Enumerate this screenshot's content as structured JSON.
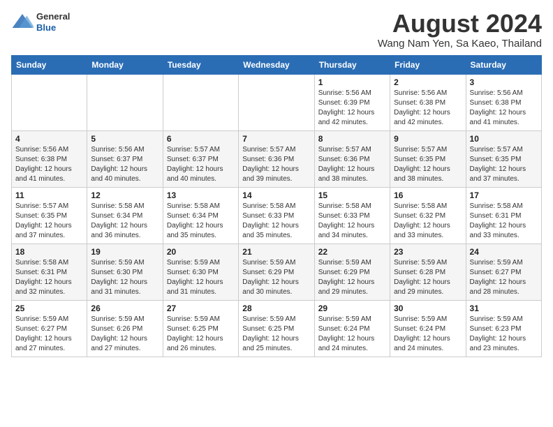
{
  "header": {
    "logo": {
      "general": "General",
      "blue": "Blue"
    },
    "title": "August 2024",
    "subtitle": "Wang Nam Yen, Sa Kaeo, Thailand"
  },
  "weekdays": [
    "Sunday",
    "Monday",
    "Tuesday",
    "Wednesday",
    "Thursday",
    "Friday",
    "Saturday"
  ],
  "weeks": [
    [
      {
        "day": "",
        "info": ""
      },
      {
        "day": "",
        "info": ""
      },
      {
        "day": "",
        "info": ""
      },
      {
        "day": "",
        "info": ""
      },
      {
        "day": "1",
        "info": "Sunrise: 5:56 AM\nSunset: 6:39 PM\nDaylight: 12 hours\nand 42 minutes."
      },
      {
        "day": "2",
        "info": "Sunrise: 5:56 AM\nSunset: 6:38 PM\nDaylight: 12 hours\nand 42 minutes."
      },
      {
        "day": "3",
        "info": "Sunrise: 5:56 AM\nSunset: 6:38 PM\nDaylight: 12 hours\nand 41 minutes."
      }
    ],
    [
      {
        "day": "4",
        "info": "Sunrise: 5:56 AM\nSunset: 6:38 PM\nDaylight: 12 hours\nand 41 minutes."
      },
      {
        "day": "5",
        "info": "Sunrise: 5:56 AM\nSunset: 6:37 PM\nDaylight: 12 hours\nand 40 minutes."
      },
      {
        "day": "6",
        "info": "Sunrise: 5:57 AM\nSunset: 6:37 PM\nDaylight: 12 hours\nand 40 minutes."
      },
      {
        "day": "7",
        "info": "Sunrise: 5:57 AM\nSunset: 6:36 PM\nDaylight: 12 hours\nand 39 minutes."
      },
      {
        "day": "8",
        "info": "Sunrise: 5:57 AM\nSunset: 6:36 PM\nDaylight: 12 hours\nand 38 minutes."
      },
      {
        "day": "9",
        "info": "Sunrise: 5:57 AM\nSunset: 6:35 PM\nDaylight: 12 hours\nand 38 minutes."
      },
      {
        "day": "10",
        "info": "Sunrise: 5:57 AM\nSunset: 6:35 PM\nDaylight: 12 hours\nand 37 minutes."
      }
    ],
    [
      {
        "day": "11",
        "info": "Sunrise: 5:57 AM\nSunset: 6:35 PM\nDaylight: 12 hours\nand 37 minutes."
      },
      {
        "day": "12",
        "info": "Sunrise: 5:58 AM\nSunset: 6:34 PM\nDaylight: 12 hours\nand 36 minutes."
      },
      {
        "day": "13",
        "info": "Sunrise: 5:58 AM\nSunset: 6:34 PM\nDaylight: 12 hours\nand 35 minutes."
      },
      {
        "day": "14",
        "info": "Sunrise: 5:58 AM\nSunset: 6:33 PM\nDaylight: 12 hours\nand 35 minutes."
      },
      {
        "day": "15",
        "info": "Sunrise: 5:58 AM\nSunset: 6:33 PM\nDaylight: 12 hours\nand 34 minutes."
      },
      {
        "day": "16",
        "info": "Sunrise: 5:58 AM\nSunset: 6:32 PM\nDaylight: 12 hours\nand 33 minutes."
      },
      {
        "day": "17",
        "info": "Sunrise: 5:58 AM\nSunset: 6:31 PM\nDaylight: 12 hours\nand 33 minutes."
      }
    ],
    [
      {
        "day": "18",
        "info": "Sunrise: 5:58 AM\nSunset: 6:31 PM\nDaylight: 12 hours\nand 32 minutes."
      },
      {
        "day": "19",
        "info": "Sunrise: 5:59 AM\nSunset: 6:30 PM\nDaylight: 12 hours\nand 31 minutes."
      },
      {
        "day": "20",
        "info": "Sunrise: 5:59 AM\nSunset: 6:30 PM\nDaylight: 12 hours\nand 31 minutes."
      },
      {
        "day": "21",
        "info": "Sunrise: 5:59 AM\nSunset: 6:29 PM\nDaylight: 12 hours\nand 30 minutes."
      },
      {
        "day": "22",
        "info": "Sunrise: 5:59 AM\nSunset: 6:29 PM\nDaylight: 12 hours\nand 29 minutes."
      },
      {
        "day": "23",
        "info": "Sunrise: 5:59 AM\nSunset: 6:28 PM\nDaylight: 12 hours\nand 29 minutes."
      },
      {
        "day": "24",
        "info": "Sunrise: 5:59 AM\nSunset: 6:27 PM\nDaylight: 12 hours\nand 28 minutes."
      }
    ],
    [
      {
        "day": "25",
        "info": "Sunrise: 5:59 AM\nSunset: 6:27 PM\nDaylight: 12 hours\nand 27 minutes."
      },
      {
        "day": "26",
        "info": "Sunrise: 5:59 AM\nSunset: 6:26 PM\nDaylight: 12 hours\nand 27 minutes."
      },
      {
        "day": "27",
        "info": "Sunrise: 5:59 AM\nSunset: 6:25 PM\nDaylight: 12 hours\nand 26 minutes."
      },
      {
        "day": "28",
        "info": "Sunrise: 5:59 AM\nSunset: 6:25 PM\nDaylight: 12 hours\nand 25 minutes."
      },
      {
        "day": "29",
        "info": "Sunrise: 5:59 AM\nSunset: 6:24 PM\nDaylight: 12 hours\nand 24 minutes."
      },
      {
        "day": "30",
        "info": "Sunrise: 5:59 AM\nSunset: 6:24 PM\nDaylight: 12 hours\nand 24 minutes."
      },
      {
        "day": "31",
        "info": "Sunrise: 5:59 AM\nSunset: 6:23 PM\nDaylight: 12 hours\nand 23 minutes."
      }
    ]
  ]
}
